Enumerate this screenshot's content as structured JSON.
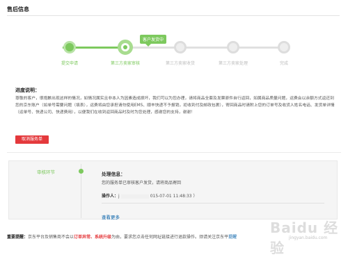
{
  "page": {
    "title": "售后信息"
  },
  "progress": {
    "bubble": "客户发货中",
    "steps": [
      {
        "label": "提交申请",
        "state": "done"
      },
      {
        "label": "第三方卖家审核",
        "state": "current"
      },
      {
        "label": "第三方卖家收货",
        "state": "todo"
      },
      {
        "label": "第三方卖家处理",
        "state": "todo"
      },
      {
        "label": "完成",
        "state": "todo"
      }
    ]
  },
  "explain": {
    "title": "进度说明：",
    "text": "尊敬的客户，很抱歉出现这样的情况，如情况属实且非本人为因素造成损坏，我们可以为您办理，请将商品全套及发票原件自行返回，如属商品质量问题，运费会以余额方式返还到您的京东账户（如单号需要问题（填表），运费将由您承担请勿使用EMS、顺丰快递不予报销，拒收到付及邮政包裹），寄回商品时请附上您的订单号及收货人姓名电话、发货单详情（运单号、快递公司、快递费用），以便我们在收到返回商品时及时为您处理，感谢您的支持，谢谢！"
  },
  "cancel_button": "取消服务单",
  "panel": {
    "stage_label": "审核环节",
    "proc_title": "处理信息：",
    "proc_text": "您的服务单已审核客户发货，请将商品寄回",
    "operator_label": "操作人：",
    "operator_prefix": "j",
    "operator_time": "015-07-01 11:48:33 ）",
    "view_more": "查看更多"
  },
  "notice": {
    "prefix": "重要提醒：",
    "part1": "京东平台及销售商不会以",
    "highlight": "订单异常、系统升级",
    "part2": "为由，要求您点击任何网址链接进行退款操作。",
    "part3": "烦请关注京东平",
    "link": "提醒"
  },
  "watermark": {
    "text": "Baidu 经验",
    "sub": "jingyan.baidu.com"
  },
  "colors": {
    "accent": "#7dc95e",
    "danger": "#e4393c",
    "link": "#005ea7"
  }
}
